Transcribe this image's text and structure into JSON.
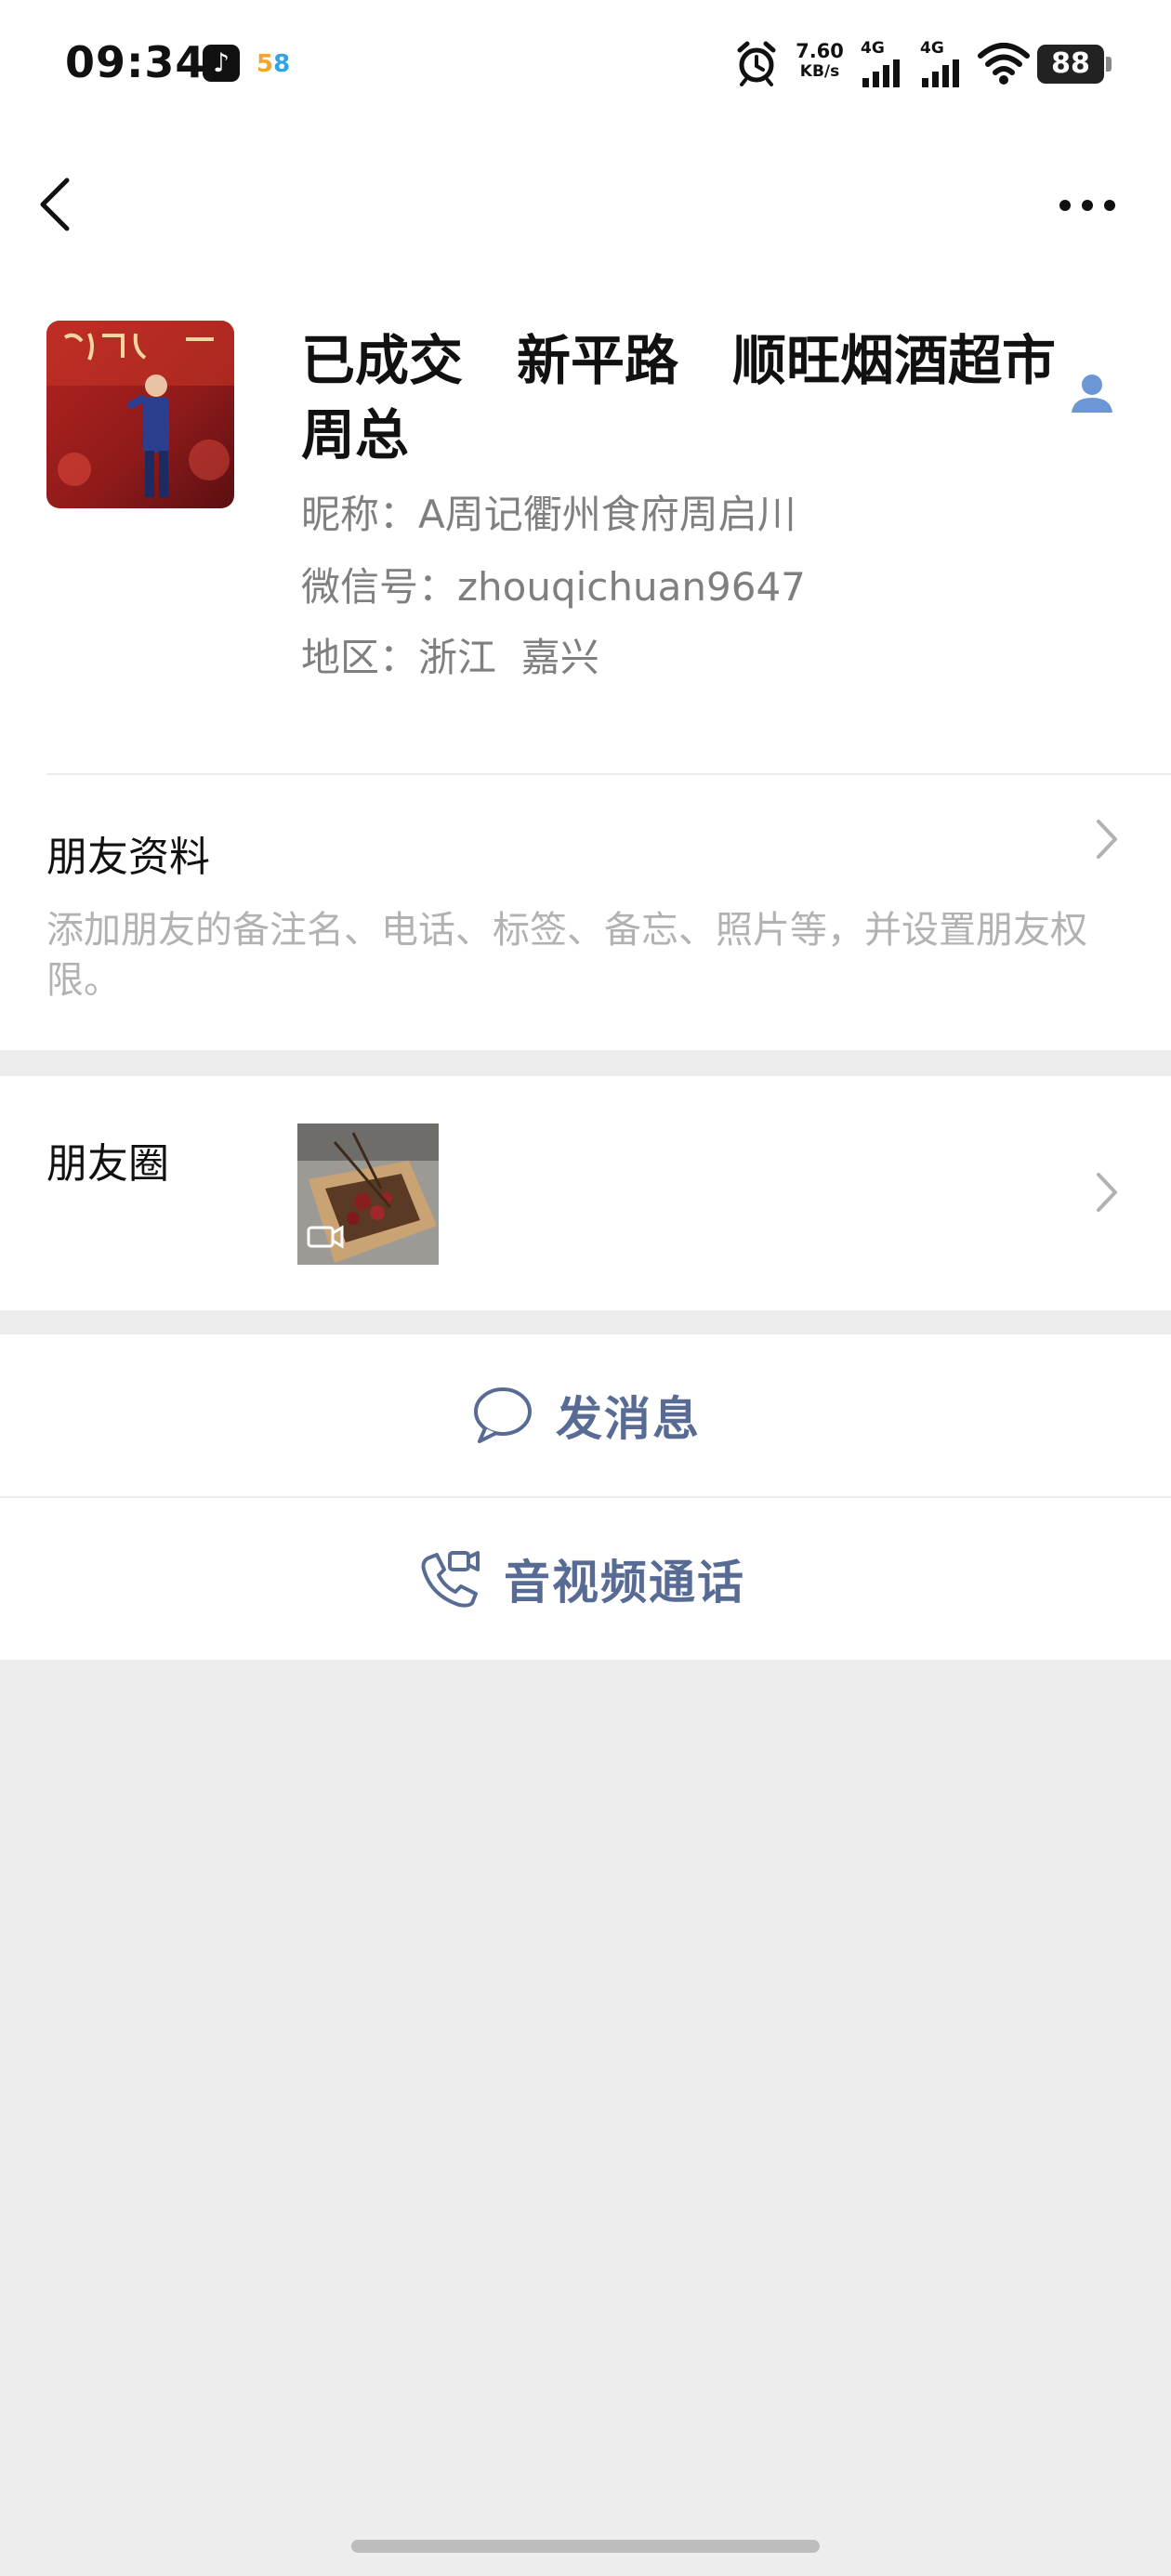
{
  "status_bar": {
    "time": "09:34",
    "app_58": "58",
    "speed_value": "7.60",
    "speed_unit": "KB/s",
    "net1": "4G",
    "net2": "4G",
    "battery": "88",
    "icons": [
      "tiktok-icon",
      "app-58-icon",
      "alarm-icon",
      "signal-icon",
      "wifi-icon",
      "battery-icon"
    ]
  },
  "nav": {
    "back_icon": "chevron-left-icon",
    "more_icon": "more-dots-icon"
  },
  "profile": {
    "name": "已成交　新平路　顺旺烟酒超市　周总",
    "nickname_line": "昵称：A周记衢州食府周启川",
    "wechat_id_line": "微信号：zhouqichuan9647",
    "region_line": "地区：浙江  嘉兴",
    "avatar_image": "avatar-photo",
    "contact_icon": "contact-person-icon"
  },
  "friend_info": {
    "title": "朋友资料",
    "description": "添加朋友的备注名、电话、标签、备忘、照片等，并设置朋友权限。"
  },
  "moments": {
    "title": "朋友圈",
    "thumbnail": "moments-video-thumbnail"
  },
  "actions": {
    "message_label": "发消息",
    "call_label": "音视频通话"
  },
  "colors": {
    "link_blue": "#576b95",
    "background": "#ededed",
    "gray_text": "#7f7f7f"
  }
}
